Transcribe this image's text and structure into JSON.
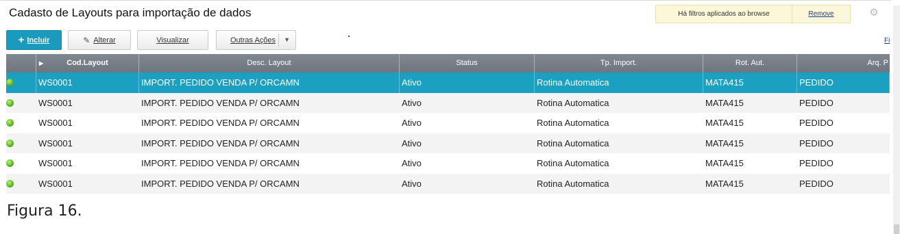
{
  "header": {
    "title": "Cadasto de Layouts para importação de dados",
    "filter_message": "Há filtros aplicados ao browse",
    "remove_link": "Remove",
    "settings_icon": "gear-icon"
  },
  "toolbar": {
    "incluir_label": "Incluir",
    "alterar_label": "Alterar",
    "visualizar_label": "Visualizar",
    "outras_acoes_label": "Outras Ações",
    "filter_link_partial": "Fi"
  },
  "grid": {
    "columns": [
      "",
      "Cod.Layout",
      "Desc. Layout",
      "Status",
      "Tp. Import.",
      "Rot. Aut.",
      "Arq. P"
    ],
    "rows": [
      {
        "code": "WS0001",
        "desc": "IMPORT. PEDIDO VENDA P/ ORCAMN",
        "status": "Ativo",
        "tp_import": "Rotina Automatica",
        "rot_aut": "MATA415",
        "arq": "PEDIDO"
      },
      {
        "code": "WS0001",
        "desc": "IMPORT. PEDIDO VENDA P/ ORCAMN",
        "status": "Ativo",
        "tp_import": "Rotina Automatica",
        "rot_aut": "MATA415",
        "arq": "PEDIDO"
      },
      {
        "code": "WS0001",
        "desc": "IMPORT. PEDIDO VENDA P/ ORCAMN",
        "status": "Ativo",
        "tp_import": "Rotina Automatica",
        "rot_aut": "MATA415",
        "arq": "PEDIDO"
      },
      {
        "code": "WS0001",
        "desc": "IMPORT. PEDIDO VENDA P/ ORCAMN",
        "status": "Ativo",
        "tp_import": "Rotina Automatica",
        "rot_aut": "MATA415",
        "arq": "PEDIDO"
      },
      {
        "code": "WS0001",
        "desc": "IMPORT. PEDIDO VENDA P/ ORCAMN",
        "status": "Ativo",
        "tp_import": "Rotina Automatica",
        "rot_aut": "MATA415",
        "arq": "PEDIDO"
      },
      {
        "code": "WS0001",
        "desc": "IMPORT. PEDIDO VENDA P/ ORCAMN",
        "status": "Ativo",
        "tp_import": "Rotina Automatica",
        "rot_aut": "MATA415",
        "arq": "PEDIDO"
      }
    ]
  },
  "caption": "Figura 16.",
  "colors": {
    "accent": "#1a9bbd",
    "selected_row": "#1ba0c1",
    "header_bg": "#767f87",
    "status_green": "#55b51d",
    "filter_bg": "#fbf7d8"
  }
}
